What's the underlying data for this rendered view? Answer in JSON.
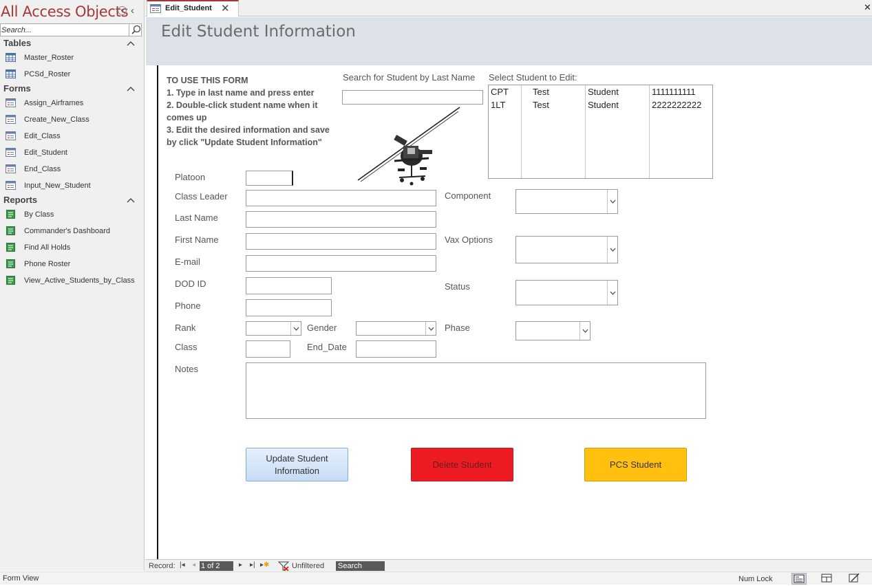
{
  "nav": {
    "title": "All Access Objects",
    "search_placeholder": "Search...",
    "groups": [
      {
        "label": "Tables",
        "items": [
          "Master_Roster",
          "PCSd_Roster"
        ]
      },
      {
        "label": "Forms",
        "items": [
          "Assign_Airframes",
          "Create_New_Class",
          "Edit_Class",
          "Edit_Student",
          "End_Class",
          "Input_New_Student"
        ]
      },
      {
        "label": "Reports",
        "items": [
          "By Class",
          "Commander's Dashboard",
          "Find All Holds",
          "Phone Roster",
          "View_Active_Students_by_Class"
        ]
      }
    ]
  },
  "tab": {
    "label": "Edit_Student"
  },
  "form": {
    "title": "Edit Student Information",
    "instructions": "TO USE THIS FORM\n1. Type in last name and press enter\n2. Double-click student name when it comes up\n3. Edit the desired information and save by click \"Update Student Information\"",
    "search_label": "Search for Student by Last Name",
    "search_value": "",
    "select_label": "Select Student to Edit:",
    "students": [
      {
        "rank": "CPT",
        "last": "Test",
        "first": "Student",
        "dod": "1111111111"
      },
      {
        "rank": "1LT",
        "last": "Test",
        "first": "Student",
        "dod": "2222222222"
      }
    ],
    "fields": {
      "platoon": {
        "label": "Platoon",
        "value": ""
      },
      "class_leader": {
        "label": "Class Leader",
        "value": ""
      },
      "last_name": {
        "label": "Last Name",
        "value": ""
      },
      "first_name": {
        "label": "First Name",
        "value": ""
      },
      "email": {
        "label": "E-mail",
        "value": ""
      },
      "dod_id": {
        "label": "DOD ID",
        "value": ""
      },
      "phone": {
        "label": "Phone",
        "value": ""
      },
      "rank": {
        "label": "Rank",
        "value": ""
      },
      "gender": {
        "label": "Gender",
        "value": ""
      },
      "class": {
        "label": "Class",
        "value": ""
      },
      "end_date": {
        "label": "End_Date",
        "value": ""
      },
      "notes": {
        "label": "Notes",
        "value": ""
      },
      "component": {
        "label": "Component",
        "value": ""
      },
      "vax": {
        "label": "Vax Options",
        "value": ""
      },
      "status": {
        "label": "Status",
        "value": ""
      },
      "phase": {
        "label": "Phase",
        "value": ""
      }
    },
    "buttons": {
      "update": "Update Student Information",
      "delete": "Delete Student",
      "pcs": "PCS Student"
    },
    "colors": {
      "delete": "#ed1c24",
      "pcs": "#ffc010",
      "update": "#c5dcf5",
      "accent": "#a4373a"
    }
  },
  "record_nav": {
    "label": "Record:",
    "position": "1 of 2",
    "filter": "Unfiltered",
    "search": "Search"
  },
  "status": {
    "view": "Form View",
    "numlock": "Num Lock"
  }
}
